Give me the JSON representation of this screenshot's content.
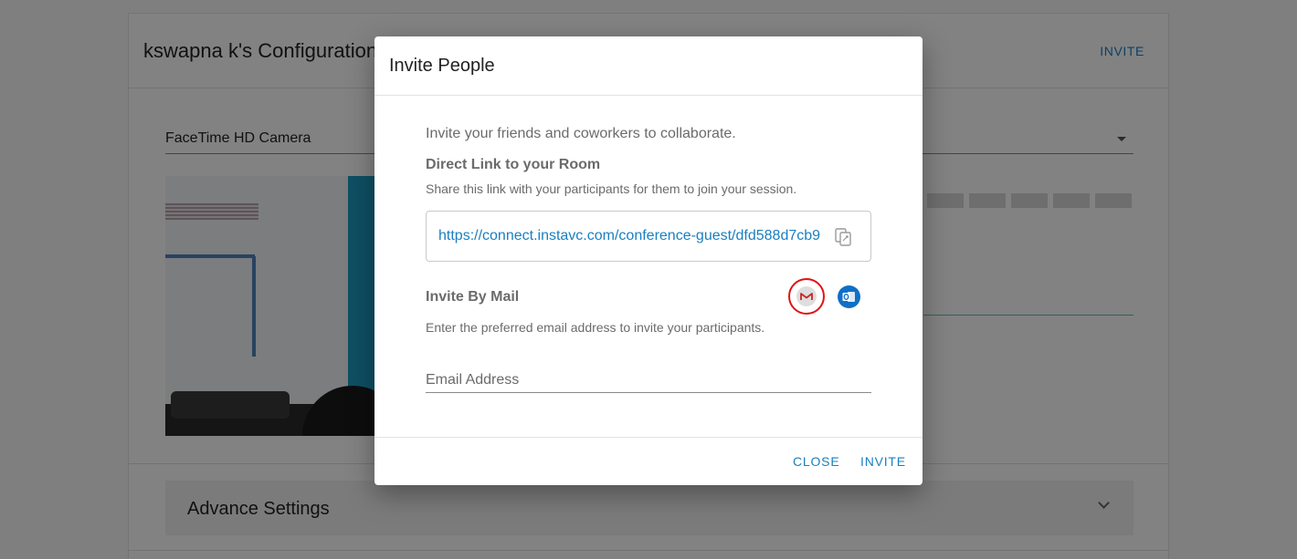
{
  "page": {
    "title": "kswapna k's Configuration",
    "invite_label": "INVITE",
    "camera_label": "FaceTime HD Camera",
    "advance_settings_label": "Advance Settings"
  },
  "dialog": {
    "title": "Invite People",
    "intro": "Invite your friends and coworkers to collaborate.",
    "direct_link_heading": "Direct Link to your Room",
    "direct_link_desc": "Share this link with your participants for them to join your session.",
    "room_link": "https://connect.instavc.com/conference-guest/dfd588d7cb9",
    "invite_by_mail_heading": "Invite By Mail",
    "invite_by_mail_desc": "Enter the preferred email address to invite your participants.",
    "email_placeholder": "Email Address",
    "close_label": "CLOSE",
    "invite_label": "INVITE"
  },
  "colors": {
    "accent": "#1a7fc1",
    "gmail_ring": "#e11414",
    "outlook": "#0f6fc6"
  },
  "icons": [
    "copy-icon",
    "gmail-icon",
    "outlook-icon",
    "caret-icon",
    "chevron-down-icon"
  ]
}
